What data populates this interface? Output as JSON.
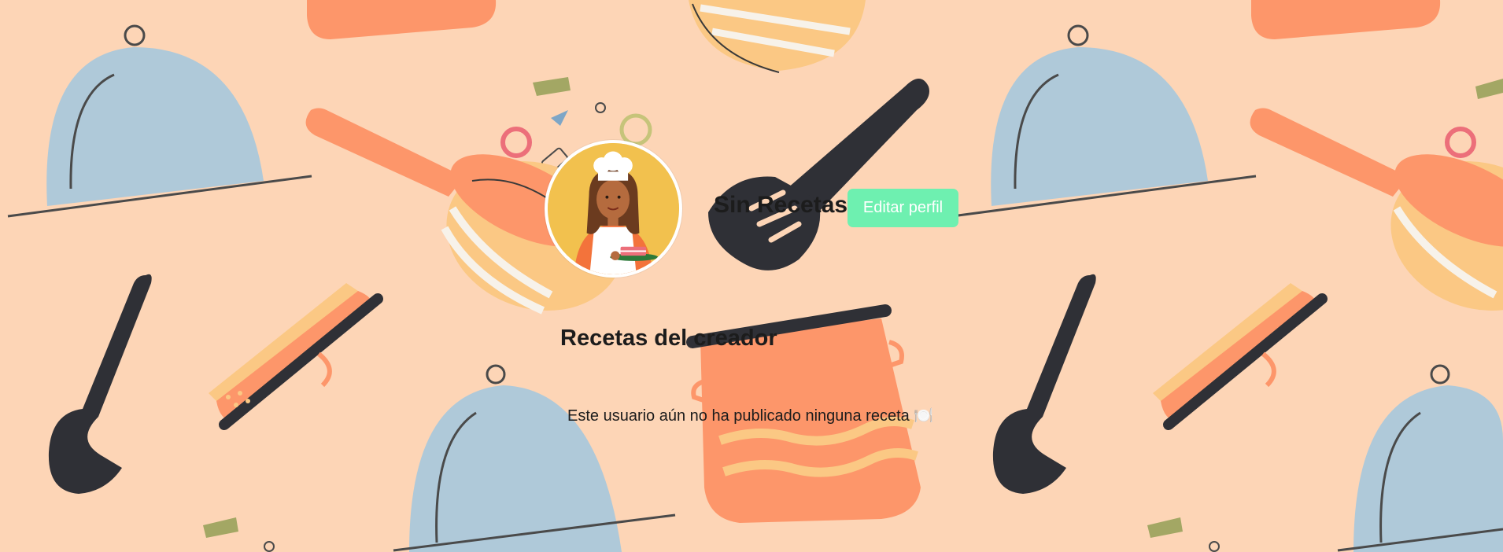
{
  "profile": {
    "username": "Sin Recetas",
    "edit_button_label": "Editar perfil"
  },
  "recipes_section": {
    "title": "Recetas del creador",
    "empty_message": "Este usuario aún no ha publicado ninguna receta 🍽️"
  },
  "colors": {
    "background": "#fdd5b6",
    "button_accent": "#6ef0b0",
    "avatar_bg": "#f2c14e"
  }
}
